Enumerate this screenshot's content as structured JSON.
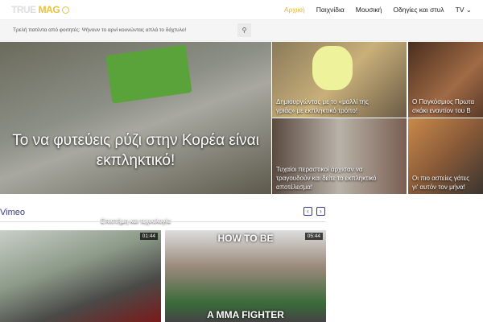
{
  "header": {
    "logo_a": "TRUE",
    "logo_b": "MAG",
    "nav": [
      "Αρχική",
      "Παιχνίδια",
      "Μουσική",
      "Οδηγίες και στυλ",
      "TV"
    ]
  },
  "ticker": {
    "text": "Τρελή πατέντα από φοιτητές: Ψήνουν το αρνί κουνώντας απλά το δάχτυλο!"
  },
  "hero": {
    "title": "Το να φυτεύεις ρύζι στην Κορέα είναι εκπληκτικό!",
    "category": "Επιστήμη και τεχνολογία"
  },
  "tiles": [
    {
      "line1": "Δημιουργώντας με το «μαλλί της",
      "line2": "γριάς» με εκπληκτικό τρόπο!"
    },
    {
      "line1": "Ο Παγκόσμιος Πρωτα",
      "line2": "σκάκι εναντίον του Β"
    },
    {
      "line1": "Τυχαίοι περαστικοί άρχισαν να",
      "line2": "τραγουδούν και δείτε το εκπληκτικό",
      "line3": "αποτέλεσμα!"
    },
    {
      "line1": "Οι πιο αστείες γάτες",
      "line2": "γι' αυτόν τον μήνα!"
    }
  ],
  "section": {
    "title": "Vimeo",
    "prev": "‹",
    "next": "›"
  },
  "videos": [
    {
      "duration": "01:44"
    },
    {
      "duration": "05:44",
      "overlay_top": "HOW TO BE",
      "overlay_bottom": "A MMA FIGHTER"
    }
  ]
}
